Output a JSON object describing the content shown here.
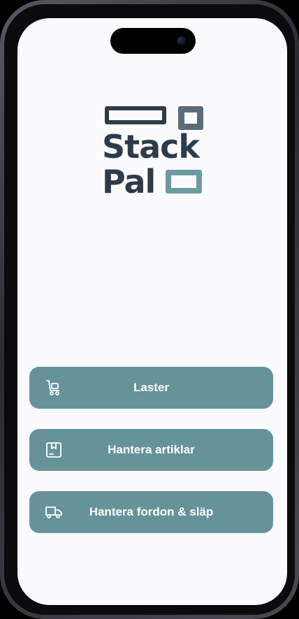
{
  "app": {
    "logo": {
      "line1": "Stack",
      "line2": "Pal"
    }
  },
  "menu": {
    "buttons": [
      {
        "label": "Laster",
        "icon": "cart-icon"
      },
      {
        "label": "Hantera artiklar",
        "icon": "box-icon"
      },
      {
        "label": "Hantera fordon & släp",
        "icon": "truck-icon"
      }
    ]
  },
  "colors": {
    "accent": "#66939a",
    "logo_dark": "#2f3b48",
    "logo_mid": "#5b6b7a",
    "logo_teal": "#6d9aa0",
    "background": "#fbfbfd"
  }
}
